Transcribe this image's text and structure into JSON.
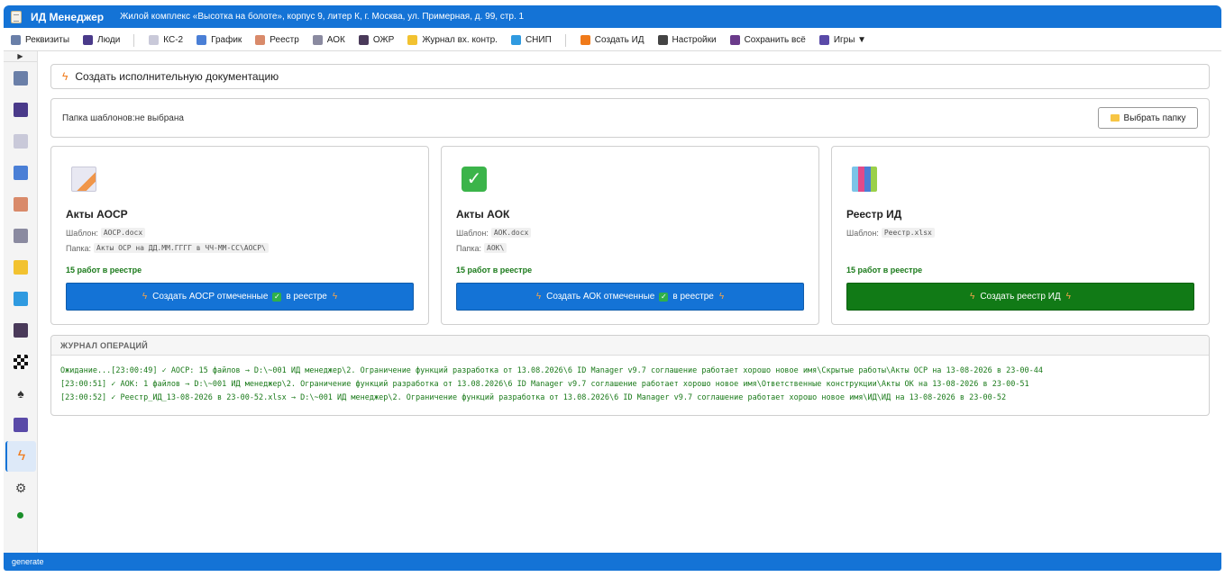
{
  "title": {
    "app": "ИД Менеджер",
    "subtitle": "Жилой комплекс «Высотка на болоте», корпус 9, литер К, г. Москва, ул. Примерная, д. 99, стр. 1"
  },
  "menu": {
    "items": [
      {
        "label": "Реквизиты",
        "icon": "building-icon",
        "color": "#6a7fa8"
      },
      {
        "label": "Люди",
        "icon": "people-icon",
        "color": "#4a3a8a"
      },
      {
        "label": "КС-2",
        "icon": "doc-icon",
        "color": "#c9c9d9"
      },
      {
        "label": "График",
        "icon": "calendar-icon",
        "color": "#4a7fd6"
      },
      {
        "label": "Реестр",
        "icon": "clipboard-icon",
        "color": "#d98a6a"
      },
      {
        "label": "АОК",
        "icon": "ruler-icon",
        "color": "#8a8aa0"
      },
      {
        "label": "ОЖР",
        "icon": "book-icon",
        "color": "#4a3a5a"
      },
      {
        "label": "Журнал вх. контр.",
        "icon": "note-icon",
        "color": "#f2c230"
      },
      {
        "label": "СНИП",
        "icon": "blue-book-icon",
        "color": "#2f9ae0"
      },
      {
        "label": "Создать ИД",
        "icon": "bolt-icon",
        "color": "#f07a1a"
      },
      {
        "label": "Настройки",
        "icon": "gear-icon",
        "color": "#444444"
      },
      {
        "label": "Сохранить всё",
        "icon": "floppy-icon",
        "color": "#6a3a8a"
      },
      {
        "label": "Игры ▼",
        "icon": "gamepad-icon",
        "color": "#5a4aa8"
      }
    ]
  },
  "sidebar": {
    "toggle": "▶",
    "items": [
      {
        "icon": "building-icon",
        "color": "#6a7fa8"
      },
      {
        "icon": "people-icon",
        "color": "#4a3a8a"
      },
      {
        "icon": "doc-icon",
        "color": "#c9c9d9"
      },
      {
        "icon": "calendar-icon",
        "color": "#4a7fd6"
      },
      {
        "icon": "clipboard-icon",
        "color": "#d98a6a"
      },
      {
        "icon": "ruler-icon",
        "color": "#8a8aa0"
      },
      {
        "icon": "note-icon",
        "color": "#f2c230"
      },
      {
        "icon": "blue-book-icon",
        "color": "#2f9ae0"
      },
      {
        "icon": "book-icon",
        "color": "#4a3a5a"
      },
      {
        "icon": "checkers-icon",
        "color": "#111111"
      },
      {
        "icon": "spade-icon",
        "color": "#333333"
      },
      {
        "icon": "gamepad-icon",
        "color": "#5a4aa8"
      },
      {
        "icon": "bolt-icon",
        "color": "#f07a1a",
        "active": true
      },
      {
        "icon": "gear-icon",
        "color": "#444444"
      }
    ]
  },
  "header": {
    "title": "Создать исполнительную документацию"
  },
  "folder": {
    "label": "Папка шаблонов:",
    "value": "не выбрана",
    "button": "Выбрать папку"
  },
  "cards": [
    {
      "title": "Акты АОСР",
      "icon": "pencil-doc-icon",
      "template_label": "Шаблон:",
      "template": "АОСР.docx",
      "folder_label": "Папка:",
      "folder": "Акты ОСР на ДД.ММ.ГГГГ в ЧЧ-ММ-СС\\АОСР\\",
      "count": "15 работ в реестре",
      "btn_pre": "Создать АОСР отмеченные",
      "btn_post": "в реестре",
      "btn_color": "#1473d6"
    },
    {
      "title": "Акты АОК",
      "icon": "check-icon",
      "template_label": "Шаблон:",
      "template": "АОК.docx",
      "folder_label": "Папка:",
      "folder": "АОК\\",
      "count": "15 работ в реестре",
      "btn_pre": "Создать АОК отмеченные",
      "btn_post": "в реестре",
      "btn_color": "#1473d6"
    },
    {
      "title": "Реестр ИД",
      "icon": "books-icon",
      "template_label": "Шаблон:",
      "template": "Реестр.xlsx",
      "count": "15 работ в реестре",
      "btn_pre": "Создать реестр ИД",
      "btn_color": "#117a16"
    }
  ],
  "log": {
    "title": "ЖУРНАЛ ОПЕРАЦИЙ",
    "lines": [
      "Ожидание...[23:00:49] ✓ АОСР: 15 файлов → D:\\~001 ИД менеджер\\2. Ограничение функций разработка от 13.08.2026\\6 ID Manager v9.7 соглашение работает хорошо новое имя\\Скрытые работы\\Акты ОСР на 13-08-2026 в 23-00-44",
      "[23:00:51] ✓ АОК: 1 файлов → D:\\~001 ИД менеджер\\2. Ограничение функций разработка от 13.08.2026\\6 ID Manager v9.7 соглашение работает хорошо новое имя\\Ответственные конструкции\\Акты ОК на 13-08-2026 в 23-00-51",
      "[23:00:52] ✓ Реестр_ИД_13-08-2026 в 23-00-52.xlsx → D:\\~001 ИД менеджер\\2. Ограничение функций разработка от 13.08.2026\\6 ID Manager v9.7 соглашение работает хорошо новое имя\\ИД\\ИД на 13-08-2026 в 23-00-52"
    ]
  },
  "status": {
    "text": "generate"
  }
}
